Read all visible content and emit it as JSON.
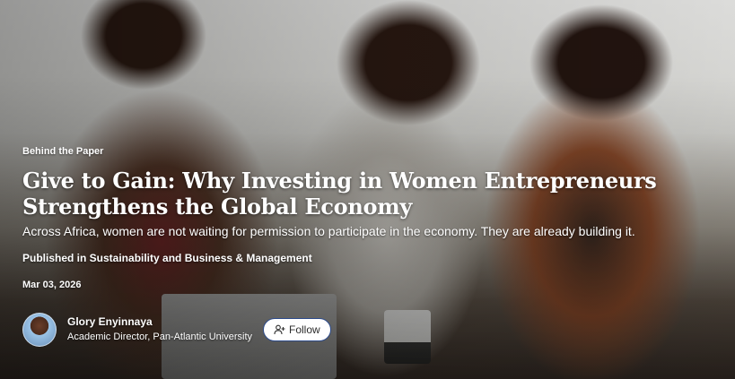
{
  "article": {
    "eyebrow": "Behind the Paper",
    "title_line1": "Give to Gain: Why Investing in Women Entrepreneurs",
    "title_line2": "Strengthens the Global Economy",
    "subtitle": "Across Africa, women are not waiting for permission to participate in the economy. They are already building it.",
    "published": "Published in Sustainability and Business & Management",
    "date": "Mar 03, 2026"
  },
  "author": {
    "name": "Glory Enyinnaya",
    "role": "Academic Director, Pan-Atlantic University",
    "follow_label": "Follow",
    "follow_icon": "add-user-icon"
  }
}
